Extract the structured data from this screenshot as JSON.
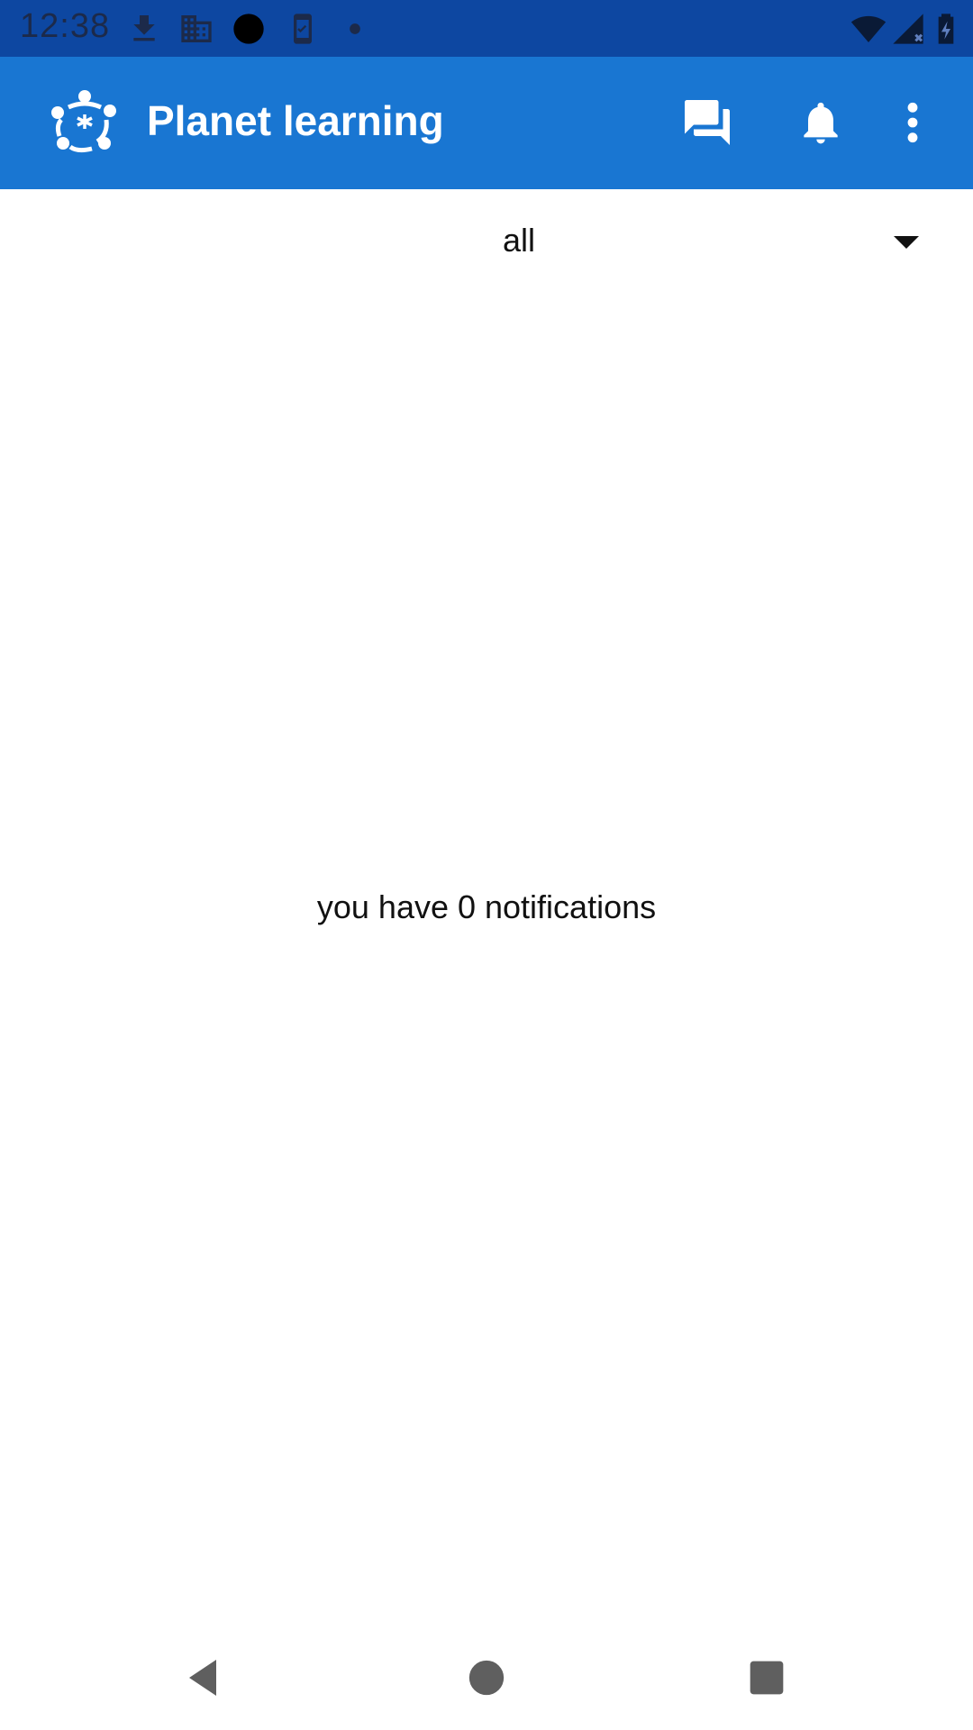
{
  "status_bar": {
    "time": "12:38",
    "icons": [
      "download-icon",
      "building-icon",
      "circle-icon",
      "phone-check-icon",
      "dot-icon",
      "wifi-icon",
      "signal-icon",
      "battery-charging-icon"
    ]
  },
  "app_bar": {
    "title": "Planet learning",
    "logo": "planet-logo-icon",
    "actions": [
      "chat-icon",
      "bell-icon",
      "more-vert-icon"
    ],
    "color": "#1976d2"
  },
  "filter": {
    "selected": "all",
    "arrow": "dropdown-arrow-icon"
  },
  "empty_state": {
    "message": "you have 0 notifications"
  },
  "nav_bar": {
    "buttons": [
      "back-icon",
      "home-icon",
      "recents-icon"
    ]
  }
}
